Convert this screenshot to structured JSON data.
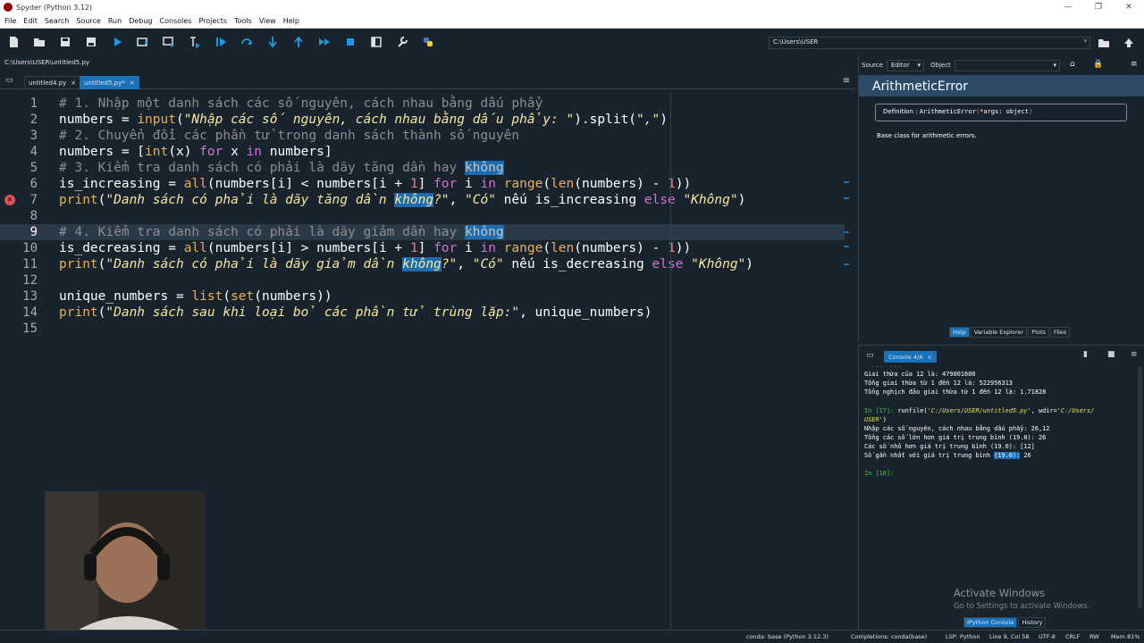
{
  "window": {
    "title": "Spyder (Python 3.12)"
  },
  "menu": [
    "File",
    "Edit",
    "Search",
    "Source",
    "Run",
    "Debug",
    "Consoles",
    "Projects",
    "Tools",
    "View",
    "Help"
  ],
  "toolbar": {
    "path": "C:\\Users\\USER",
    "icons": [
      "new-file-icon",
      "open-file-icon",
      "save-icon",
      "save-all-icon",
      "run-icon",
      "run-cell-icon",
      "run-cell-advance-icon",
      "run-selection-icon",
      "debug-icon",
      "step-icon",
      "step-into-icon",
      "step-return-icon",
      "continue-icon",
      "stop-icon",
      "maximize-pane-icon",
      "preferences-icon",
      "python-path-icon"
    ]
  },
  "editor": {
    "path": "C:\\Users\\USER\\untitled5.py",
    "tabs": [
      {
        "label": "untitled4.py",
        "close": "×"
      },
      {
        "label": "untitled5.py*",
        "close": "×"
      }
    ],
    "line_numbers": [
      "1",
      "2",
      "3",
      "4",
      "5",
      "6",
      "7",
      "8",
      "9",
      "10",
      "11",
      "12",
      "13",
      "14",
      "15"
    ],
    "breakpoint_line": "7",
    "current_line": "9",
    "code": {
      "l1": "# 1. Nhập một danh sách các số nguyên, cách nhau bằng dấu phẩy",
      "l2_a": "numbers = ",
      "l2_b": "input",
      "l2_c": "(",
      "l2_d": "\"Nhập các số nguyên, cách nhau bằng dấu phẩy: \"",
      "l2_e": ").split(",
      "l2_f": "\",\"",
      "l2_g": ")",
      "l3": "# 2. Chuyển đổi các phần tử trong danh sách thành số nguyên",
      "l4_a": "numbers = [",
      "l4_b": "int",
      "l4_c": "(x) ",
      "l4_d": "for",
      "l4_e": " x ",
      "l4_f": "in",
      "l4_g": " numbers]",
      "l5_a": "# 3. Kiểm tra danh sách có phải là dãy tăng dần hay ",
      "l5_b": "không",
      "l6_a": "is_increasing = ",
      "l6_b": "all",
      "l6_c": "(numbers[i] < numbers[i + ",
      "l6_d": "1",
      "l6_e": "] ",
      "l6_f": "for",
      "l6_g": " i ",
      "l6_h": "in",
      "l6_i": " ",
      "l6_j": "range",
      "l6_k": "(",
      "l6_l": "len",
      "l6_m": "(numbers) - ",
      "l6_n": "1",
      "l6_o": "))",
      "l7_a": "print",
      "l7_b": "(",
      "l7_c": "\"Danh sách có phải là dãy tăng dần ",
      "l7_d": "không",
      "l7_e": "?\"",
      "l7_f": ", ",
      "l7_g": "\"Có\"",
      "l7_h": " nếu is_increasing ",
      "l7_i": "else",
      "l7_j": " ",
      "l7_k": "\"Không\"",
      "l7_l": ")",
      "l9_a": "# 4. Kiểm tra danh sách có phải là dãy giảm dần hay ",
      "l9_b": "không",
      "l10_a": "is_decreasing = ",
      "l10_b": "all",
      "l10_c": "(numbers[i] > numbers[i + ",
      "l10_d": "1",
      "l10_e": "] ",
      "l10_f": "for",
      "l10_g": " i ",
      "l10_h": "in",
      "l10_i": " ",
      "l10_j": "range",
      "l10_k": "(",
      "l10_l": "len",
      "l10_m": "(numbers) - ",
      "l10_n": "1",
      "l10_o": "))",
      "l11_a": "print",
      "l11_b": "(",
      "l11_c": "\"Danh sách có phải là dãy giảm dần ",
      "l11_d": "không",
      "l11_e": "?\"",
      "l11_f": ", ",
      "l11_g": "\"Có\"",
      "l11_h": " nếu is_decreasing ",
      "l11_i": "else",
      "l11_j": " ",
      "l11_k": "\"Không\"",
      "l11_l": ")",
      "l13_a": "unique_numbers = ",
      "l13_b": "list",
      "l13_c": "(",
      "l13_d": "set",
      "l13_e": "(numbers))",
      "l14_a": "print",
      "l14_b": "(",
      "l14_c": "\"Danh sách sau khi loại bỏ các phần tử trùng lặp:\"",
      "l14_d": ", unique_numbers)"
    }
  },
  "help": {
    "source_label": "Source",
    "source_value": "Editor",
    "object_label": "Object",
    "object_value": "",
    "title": "ArithmeticError",
    "definition_label": "Definition :",
    "definition_name": "ArithmeticError",
    "definition_open": "(",
    "definition_args": "*args: object",
    "definition_close": ")",
    "description": "Base class for arithmetic errors.",
    "tabs": [
      "Help",
      "Variable Explorer",
      "Plots",
      "Files"
    ]
  },
  "console": {
    "tab_label": "Console 4/A",
    "lines": {
      "c0": "  ...  ...",
      "c1": "Giai thừa của 12 là: 479001600",
      "c2": "Tổng giai thừa từ 1 đến 12 là: 522956313",
      "c3": "Tổng nghịch đảo giai thừa từ 1 đến 12 là: 1.71828",
      "c5_prompt": "In [17]: ",
      "c5_cmd": "runfile(",
      "c5_str1": "'C:/Users/USER/untitled5.py'",
      "c5_mid": ", wdir=",
      "c5_str2": "'C:/Users/",
      "c6_str": "USER'",
      "c6_end": ")",
      "c7": "Nhập các số nguyên, cách nhau bằng dấu phẩy: 26,12",
      "c8": "Tổng các số lớn hơn giá trị trung bình (19.0): 26",
      "c9": "Các số nhỏ hơn giá trị trung bình (19.0): [12]",
      "c10_a": "Số gần nhất với giá trị trung bình ",
      "c10_b": "(19.0):",
      "c10_c": " 26",
      "c12_prompt": "In [18]:"
    },
    "watermark_title": "Activate Windows",
    "watermark_sub": "Go to Settings to activate Windows.",
    "tabs": [
      "IPython Console",
      "History"
    ]
  },
  "status": {
    "conda": "conda: base (Python 3.12.3)",
    "completions": "Completions: conda(base)",
    "lsp": "LSP: Python",
    "position": "Line 9, Col 58",
    "encoding": "UTF-8",
    "eol": "CRLF",
    "rw": "RW",
    "mem": "Mem 81%"
  }
}
